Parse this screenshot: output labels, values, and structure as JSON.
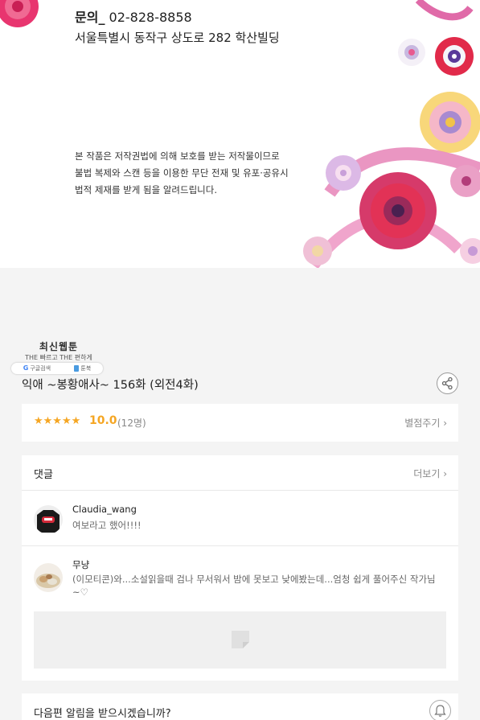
{
  "banner": {
    "contact_label": "문의_",
    "contact_phone": "02-828-8858",
    "address": "서울특별시 동작구 상도로 282 학산빌딩",
    "notice_lines": [
      "본 작품은 저작권법에 의해 보호를 받는 저작물이므로",
      "불법 복제와 스캔 등을 이용한 무단 전재 및 유포·공유시",
      "법적 제재를 받게 됨을 알려드립니다."
    ]
  },
  "badge": {
    "title": "최신웹툰",
    "subtitle": "THE 빠르고 THE 편하게",
    "google": "구글검색",
    "book": "툰북"
  },
  "episode": {
    "title": "익애 ~봉황애사~ 156화 (외전4화)"
  },
  "rating": {
    "stars_text": "★★★★★",
    "score": "10.0",
    "count": "(12명)",
    "rate_link": "별점주기 ›",
    "stars_filled": 5
  },
  "comments": {
    "label": "댓글",
    "more": "더보기 ›",
    "items": [
      {
        "name": "Claudia_wang",
        "text": "여보라고 했어!!!!"
      },
      {
        "name": "무냥",
        "text": "(이모티콘)와...소설읽을때 검나 무서워서 밤에 못보고 낮에봤는데...엄청 쉽게 풀어주신 작가님~♡"
      }
    ]
  },
  "alarm": {
    "question": "다음편 알림을 받으시겠습니까?"
  },
  "colors": {
    "accent": "#f5a623",
    "background": "#f4f4f4"
  },
  "icons": {
    "share": "share-icon",
    "bell": "bell-icon",
    "image_placeholder": "image-placeholder-icon"
  }
}
